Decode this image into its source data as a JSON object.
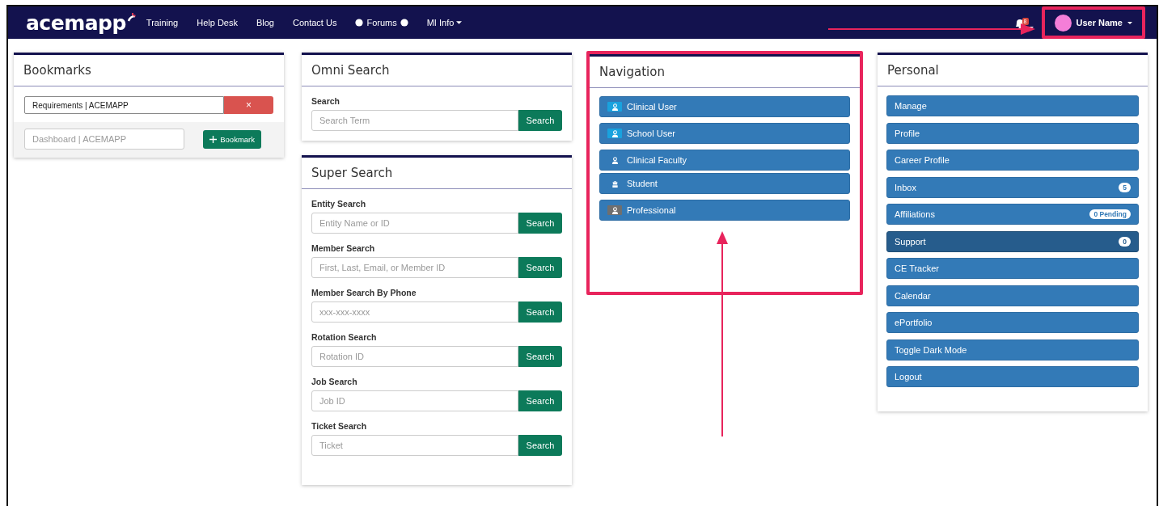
{
  "navbar": {
    "logo": "acemapp",
    "links": [
      {
        "label": "Training",
        "kind": "plain"
      },
      {
        "label": "Help Desk",
        "kind": "plain"
      },
      {
        "label": "Blog",
        "kind": "plain"
      },
      {
        "label": "Contact Us",
        "kind": "plain"
      },
      {
        "label": "Forums",
        "kind": "dotted"
      },
      {
        "label": "MI Info",
        "kind": "dropdown"
      }
    ],
    "notifications": {
      "count": "8"
    },
    "user": {
      "name": "User Name"
    }
  },
  "bookmarks": {
    "title": "Bookmarks",
    "saved": [
      {
        "value": "Requirements | ACEMAPP",
        "delete": "×"
      }
    ],
    "new": {
      "placeholder": "Dashboard | ACEMAPP",
      "button": "Bookmark"
    }
  },
  "omni_search": {
    "title": "Omni Search",
    "fields": [
      {
        "label": "Search",
        "placeholder": "Search Term",
        "button": "Search"
      }
    ]
  },
  "super_search": {
    "title": "Super Search",
    "fields": [
      {
        "label": "Entity Search",
        "placeholder": "Entity Name or ID",
        "button": "Search"
      },
      {
        "label": "Member Search",
        "placeholder": "First, Last, Email, or Member ID",
        "button": "Search"
      },
      {
        "label": "Member Search By Phone",
        "placeholder": "xxx-xxx-xxxx",
        "button": "Search"
      },
      {
        "label": "Rotation Search",
        "placeholder": "Rotation ID",
        "button": "Search"
      },
      {
        "label": "Job Search",
        "placeholder": "Job ID",
        "button": "Search"
      },
      {
        "label": "Ticket Search",
        "placeholder": "Ticket",
        "button": "Search"
      }
    ]
  },
  "navigation": {
    "title": "Navigation",
    "items": [
      {
        "label": "Clinical User",
        "kind": "user",
        "color": "#19a2de"
      },
      {
        "label": "School User",
        "kind": "user",
        "color": "#19a2de"
      },
      {
        "label": "Clinical Faculty",
        "kind": "user",
        "color": "#337ab7"
      },
      {
        "label": "Student",
        "kind": "student",
        "color": "#337ab7"
      },
      {
        "label": "Professional",
        "kind": "user",
        "color": "#6f6f6f"
      }
    ]
  },
  "personal": {
    "title": "Personal",
    "items": [
      {
        "label": "Manage",
        "selected": false
      },
      {
        "label": "Profile",
        "selected": false
      },
      {
        "label": "Career Profile",
        "selected": false
      },
      {
        "label": "Inbox",
        "selected": false,
        "badge": "5"
      },
      {
        "label": "Affiliations",
        "selected": false,
        "badge": "0 Pending"
      },
      {
        "label": "Support",
        "selected": true,
        "badge": "0"
      },
      {
        "label": "CE Tracker",
        "selected": false
      },
      {
        "label": "Calendar",
        "selected": false
      },
      {
        "label": "ePortfolio",
        "selected": false
      },
      {
        "label": "Toggle Dark Mode",
        "selected": false
      },
      {
        "label": "Logout",
        "selected": false
      }
    ]
  }
}
